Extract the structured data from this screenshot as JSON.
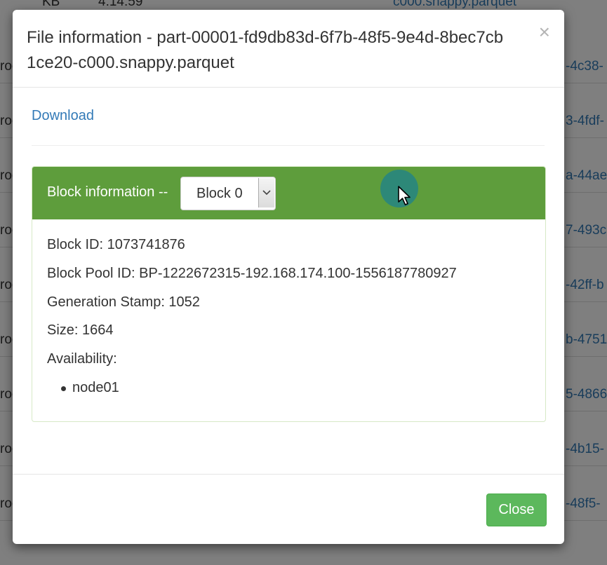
{
  "background": {
    "top_row": {
      "size": "KB",
      "time": "4:14:59",
      "name": "c000.snappy.parquet"
    },
    "rows": [
      {
        "owner": "root",
        "name_tail": "-4c38-"
      },
      {
        "owner": "root",
        "name_tail": "3-4fdf-"
      },
      {
        "owner": "root",
        "name_tail": "a-44ae"
      },
      {
        "owner": "root",
        "name_tail": "7-493c"
      },
      {
        "owner": "root",
        "name_tail": "-42ff-b"
      },
      {
        "owner": "root",
        "name_tail": "b-4751"
      },
      {
        "owner": "root",
        "name_tail": "5-4866"
      },
      {
        "owner": "root",
        "name_tail": "-4b15-"
      },
      {
        "owner": "root",
        "name_tail": "-48f5-"
      }
    ]
  },
  "modal": {
    "title": "File information - part-00001-fd9db83d-6f7b-48f5-9e4d-8bec7cb1ce20-c000.snappy.parquet",
    "close_symbol": "×",
    "download_label": "Download",
    "block_panel": {
      "heading_label": "Block information --",
      "selected_block": "Block 0",
      "dropdown_icon": "chevron-down-icon",
      "block_id": "Block ID: 1073741876",
      "block_pool_id": "Block Pool ID: BP-1222672315-192.168.174.100-1556187780927",
      "generation_stamp": "Generation Stamp: 1052",
      "size": "Size: 1664",
      "availability_label": "Availability:",
      "availability_nodes": [
        "node01"
      ]
    },
    "close_button_label": "Close"
  },
  "colors": {
    "panel_heading": "#5e9d3c",
    "close_button": "#5cb85c",
    "link": "#337ab7"
  }
}
